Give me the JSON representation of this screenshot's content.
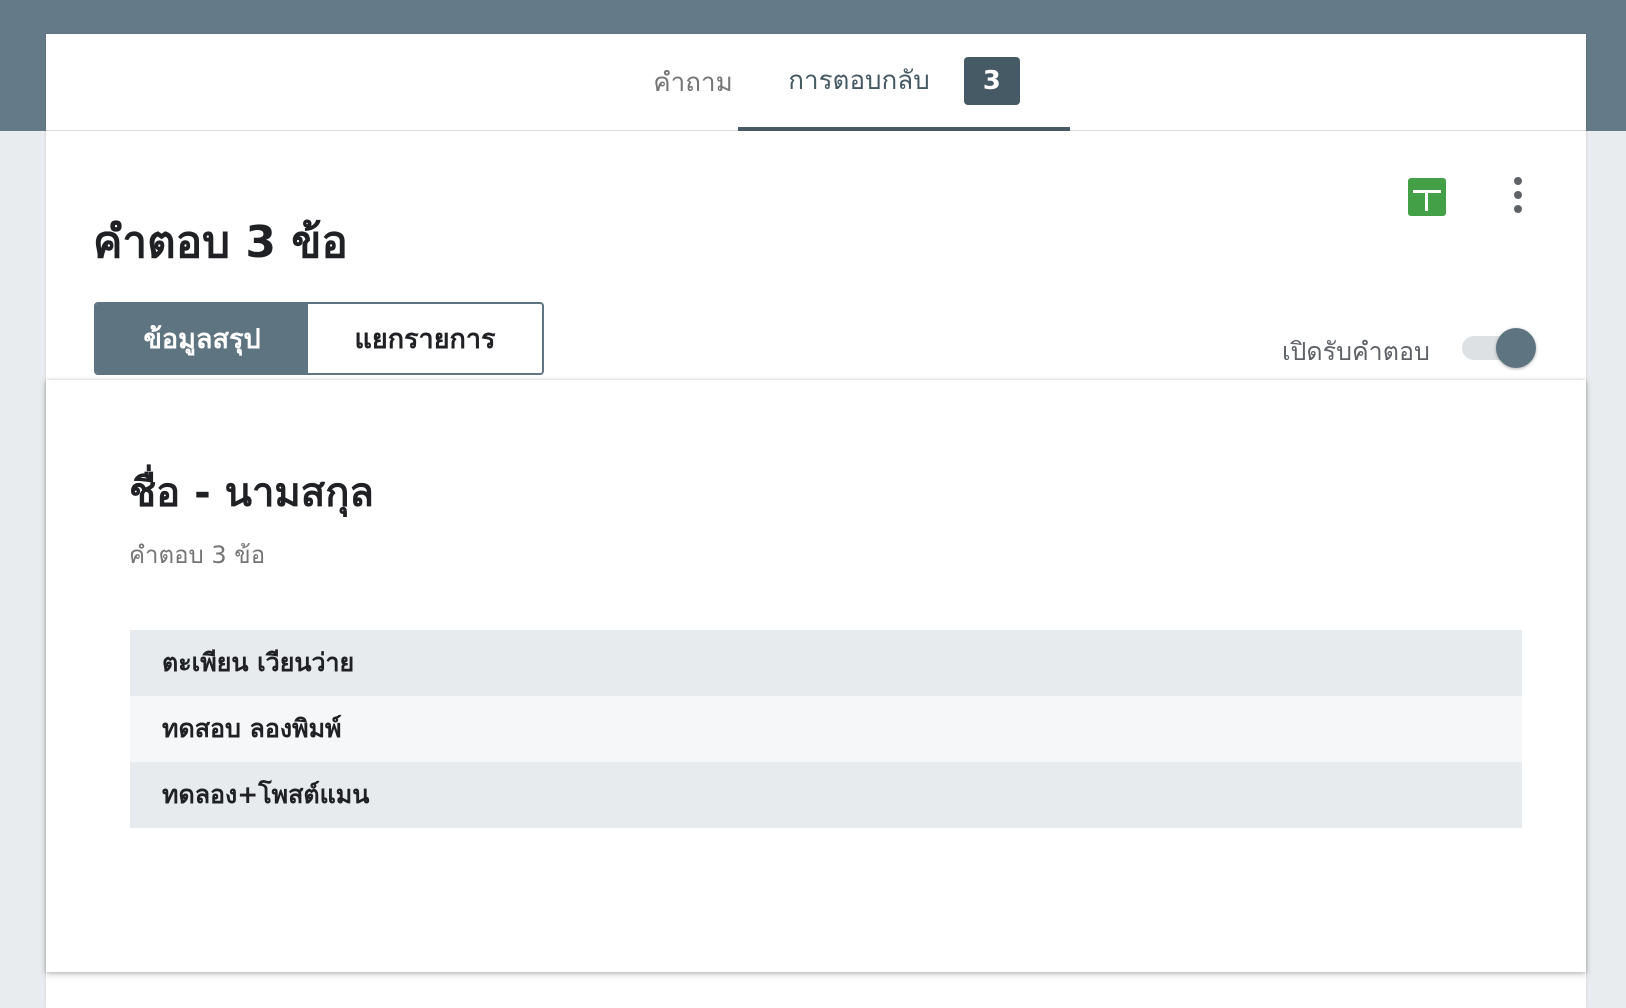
{
  "tabs": {
    "questions_label": "คำถาม",
    "responses_label": "การตอบกลับ",
    "responses_count": "3"
  },
  "header": {
    "title": "คำตอบ 3 ข้อ",
    "sheets_icon": "spreadsheet-add-icon",
    "more_icon": "more-vert-icon",
    "summary_label": "ข้อมูลสรุป",
    "individual_label": "แยกรายการ",
    "accepting_label": "เปิดรับคำตอบ",
    "accepting_on": true
  },
  "question": {
    "title": "ชื่อ - นามสกุล",
    "count_text": "คำตอบ 3 ข้อ",
    "answers": [
      "ตะเพียน เวียนว่าย",
      "ทดสอบ ลองพิมพ์",
      "ทดลอง+โพสต์แมน"
    ]
  },
  "colors": {
    "top_band": "#647a88",
    "accent": "#455a64",
    "sheets_green": "#43a047"
  }
}
